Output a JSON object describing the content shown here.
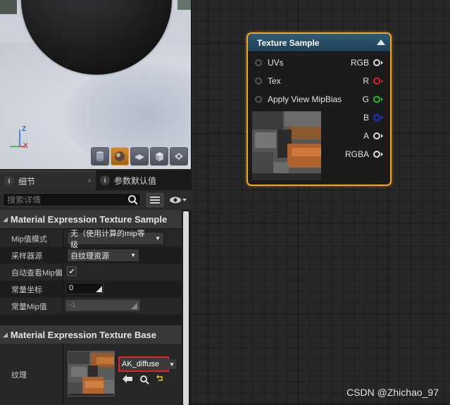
{
  "viewport": {
    "axis_z": "Z",
    "axis_x": "X",
    "toolbar_icons": [
      "cylinder-icon",
      "sphere-icon",
      "plane-icon",
      "cube-icon",
      "custom-mesh-icon"
    ]
  },
  "details": {
    "tabs": [
      {
        "label": "细节",
        "close": "×"
      },
      {
        "label": "参数默认值"
      }
    ],
    "search_placeholder": "搜索详情",
    "sections": {
      "texture_sample": {
        "title": "Material Expression Texture Sample",
        "rows": {
          "mip_mode": {
            "label": "Mip值模式",
            "value": "无（使用计算的mip等级"
          },
          "sampler_source": {
            "label": "采样器源",
            "value": "自纹理资源"
          },
          "auto_view_mip": {
            "label": "自动查看Mip偏",
            "checked": true
          },
          "const_coord": {
            "label": "常量坐标",
            "value": "0"
          },
          "const_mip": {
            "label": "常量Mip值",
            "value": "-1"
          }
        }
      },
      "texture_base": {
        "title": "Material Expression Texture Base",
        "texture_label": "纹理",
        "texture_name": "AK_diffuse"
      }
    }
  },
  "node": {
    "title": "Texture Sample",
    "inputs": [
      "UVs",
      "Tex",
      "Apply View MipBias"
    ],
    "outputs": [
      {
        "label": "RGB",
        "color": "#dddddd"
      },
      {
        "label": "R",
        "color": "#e02020"
      },
      {
        "label": "G",
        "color": "#20c020"
      },
      {
        "label": "B",
        "color": "#2030e0"
      },
      {
        "label": "A",
        "color": "#dddddd"
      },
      {
        "label": "RGBA",
        "color": "#dddddd"
      }
    ]
  },
  "watermark": "CSDN @Zhichao_97",
  "colors": {
    "node_border": "#f5a623",
    "node_header": "#2f5a74",
    "highlight": "#e0202a"
  }
}
